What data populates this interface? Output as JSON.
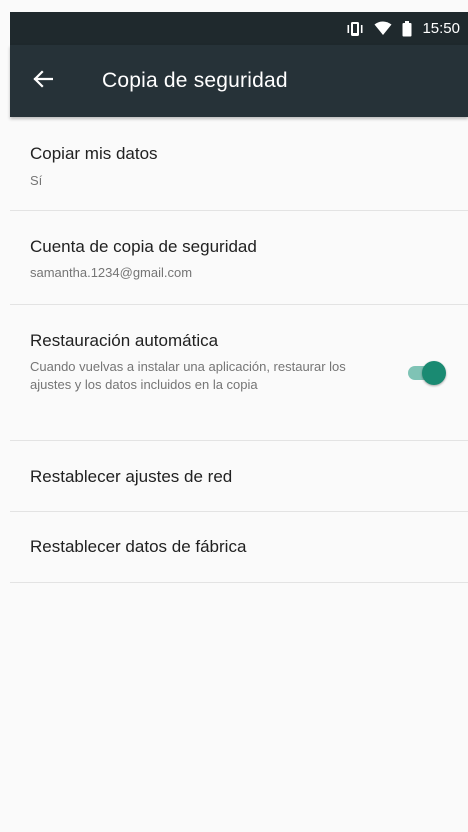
{
  "status_bar": {
    "time": "15:50",
    "icons": [
      "vibrate-icon",
      "wifi-icon",
      "battery-icon"
    ]
  },
  "app_bar": {
    "title": "Copia de seguridad",
    "back_icon": "arrow-back-icon"
  },
  "settings": [
    {
      "title": "Copiar mis datos",
      "summary": "Sí"
    },
    {
      "title": "Cuenta de copia de seguridad",
      "summary": "samantha.1234@gmail.com"
    },
    {
      "title": "Restauración automática",
      "summary": "Cuando vuelvas a instalar una aplicación, restaurar los ajustes y los datos incluidos en la copia",
      "toggle_on": true
    },
    {
      "title": "Restablecer ajustes de red"
    },
    {
      "title": "Restablecer datos de fábrica"
    }
  ],
  "colors": {
    "status_bar": "#1f292d",
    "app_bar": "#263238",
    "accent": "#1a8a72",
    "toggle_track": "#7fc3b5"
  }
}
